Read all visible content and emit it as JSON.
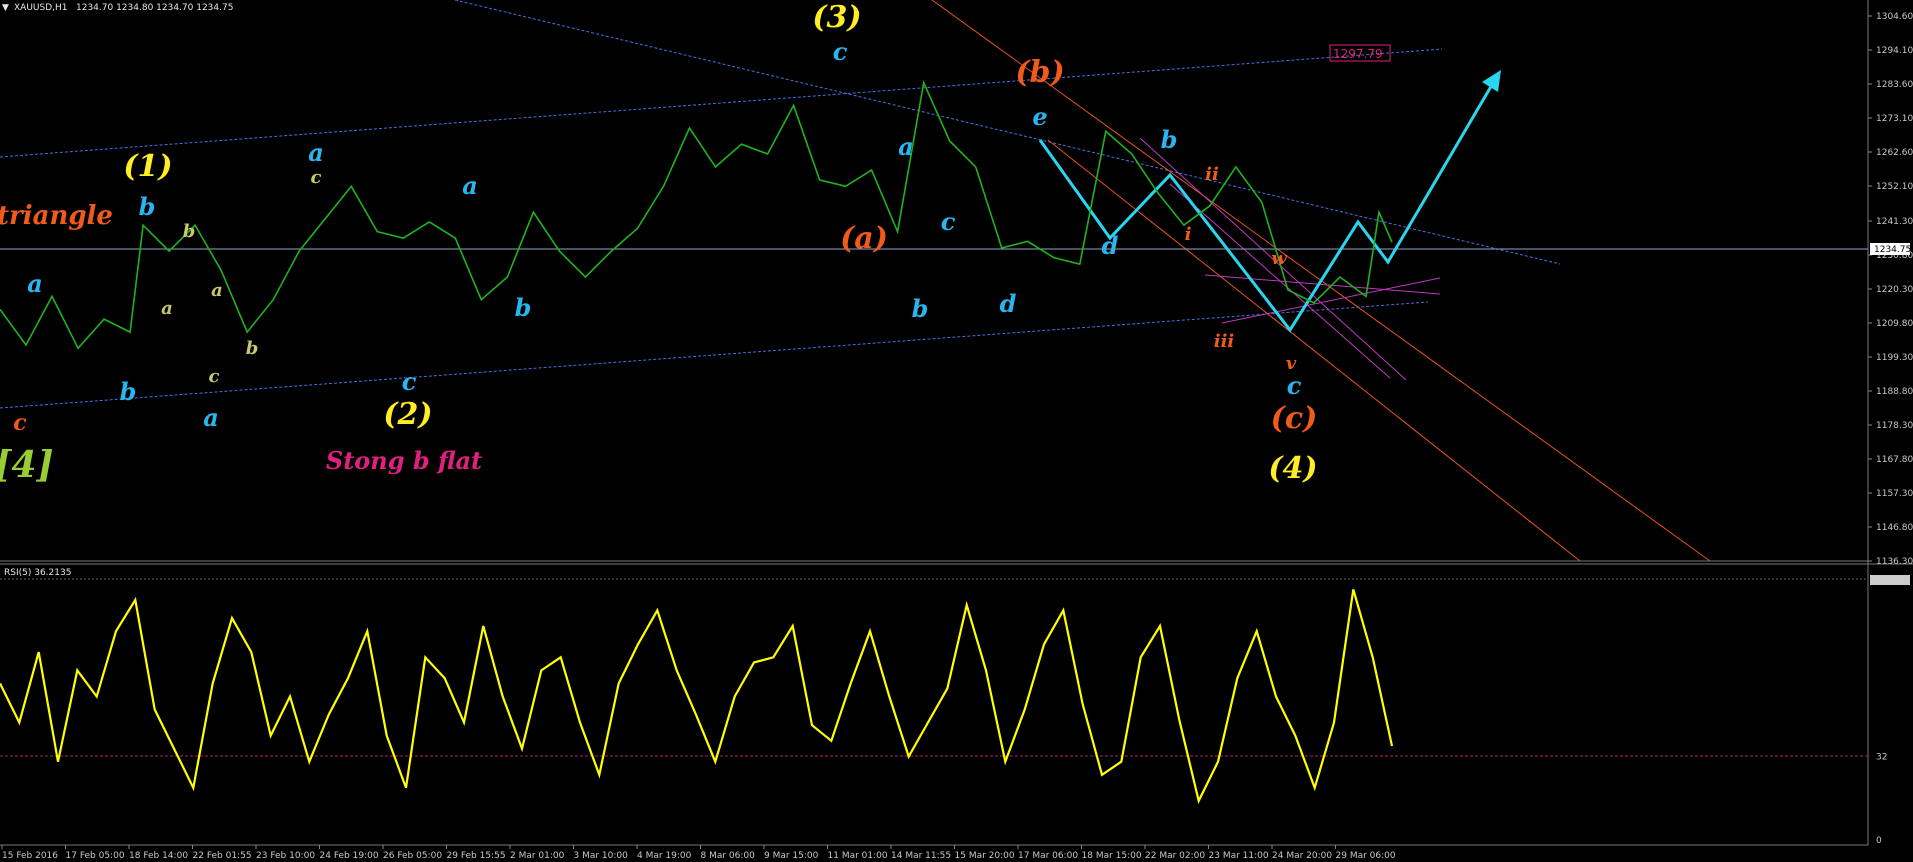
{
  "header": {
    "symbol": "XAUUSD,H1",
    "ohlc": "1234.70 1234.80 1234.70 1234.75",
    "indicator": "RSI(5) 36.2135"
  },
  "chart_data": [
    {
      "type": "line",
      "instrument": "XAUUSD",
      "timeframe": "H1",
      "ylim": [
        1136.3,
        1304.6
      ],
      "y_ticks": [
        "1304.60",
        "1294.10",
        "1283.60",
        "1273.10",
        "1262.60",
        "1252.10",
        "1241.30",
        "1230.80",
        "1220.30",
        "1209.80",
        "1199.30",
        "1188.80",
        "1178.30",
        "1167.80",
        "1157.30",
        "1146.80",
        "1136.30"
      ],
      "x_ticks": [
        "15 Feb 2016",
        "17 Feb 05:00",
        "18 Feb 14:00",
        "22 Feb 01:55",
        "23 Feb 10:00",
        "24 Feb 19:00",
        "26 Feb 05:00",
        "29 Feb 15:55",
        "2 Mar 01:00",
        "3 Mar 10:00",
        "4 Mar 19:00",
        "8 Mar 06:00",
        "9 Mar 15:00",
        "11 Mar 01:00",
        "14 Mar 11:55",
        "15 Mar 20:00",
        "17 Mar 06:00",
        "18 Mar 15:00",
        "22 Mar 02:00",
        "23 Mar 11:00",
        "24 Mar 20:00",
        "29 Mar 06:00"
      ],
      "current_price": "1234.75",
      "price_label": "1297.79",
      "series": [
        {
          "color": "#1fb31f",
          "x_index": [
            0,
            0.4,
            0.8,
            1.2,
            1.6,
            2.0,
            2.2,
            2.6,
            3.0,
            3.4,
            3.8,
            4.2,
            4.6,
            5.0,
            5.4,
            5.8,
            6.2,
            6.6,
            7.0,
            7.4,
            7.8,
            8.2,
            8.6,
            9.0,
            9.4,
            9.8,
            10.2,
            10.6,
            11.0,
            11.4,
            11.8,
            12.2,
            12.6,
            13.0,
            13.4,
            13.8,
            14.2,
            14.6,
            15.0,
            15.4,
            15.8,
            16.2,
            16.6,
            17.0,
            17.4,
            17.8,
            18.2,
            18.6,
            19.0,
            19.4,
            19.8,
            20.2,
            20.6,
            21.0,
            21.2,
            21.4
          ],
          "values": [
            1214,
            1203,
            1218,
            1202,
            1211,
            1207,
            1240,
            1232,
            1240,
            1226,
            1207,
            1217,
            1232,
            1242,
            1252,
            1238,
            1236,
            1241,
            1236,
            1217,
            1224,
            1244,
            1232,
            1224,
            1232,
            1239,
            1252,
            1270,
            1258,
            1265,
            1262,
            1277,
            1254,
            1252,
            1257,
            1238,
            1284,
            1266,
            1258,
            1233,
            1235,
            1230,
            1228,
            1269,
            1262,
            1250,
            1240,
            1246,
            1258,
            1247,
            1220,
            1216,
            1224,
            1218,
            1244,
            1234.75
          ]
        }
      ],
      "elliott_labels": {
        "yellow": [
          "(3)",
          "(1)",
          "(2)",
          "(4)",
          "[4]"
        ],
        "orange": [
          "(b)",
          "(a)",
          "(c)",
          "triangle",
          "c",
          "ii",
          "i",
          "w",
          "iii",
          "v"
        ],
        "blue": [
          "c",
          "a",
          "b",
          "a",
          "a",
          "b",
          "c",
          "a",
          "b",
          "a",
          "c",
          "b",
          "d",
          "e",
          "d",
          "b",
          "c"
        ],
        "small": [
          "c",
          "b",
          "a",
          "a",
          "b",
          "c"
        ],
        "magenta": [
          "Stong b flat"
        ]
      }
    },
    {
      "type": "line",
      "indicator": "RSI(5)",
      "ylim": [
        0,
        100
      ],
      "y_ticks": [
        "100",
        "32",
        "0"
      ],
      "last_value": "36.2135",
      "level": 32,
      "series": [
        {
          "color": "#ffff00",
          "values": [
            60,
            45,
            72,
            30,
            65,
            55,
            80,
            92,
            50,
            35,
            20,
            60,
            85,
            72,
            40,
            55,
            30,
            48,
            62,
            80,
            40,
            20,
            70,
            62,
            45,
            82,
            55,
            35,
            65,
            70,
            45,
            25,
            60,
            75,
            88,
            65,
            48,
            30,
            55,
            68,
            70,
            82,
            44,
            38,
            60,
            80,
            55,
            32,
            45,
            58,
            90,
            65,
            30,
            50,
            75,
            88,
            52,
            25,
            30,
            70,
            82,
            46,
            15,
            30,
            62,
            80,
            55,
            40,
            20,
            45,
            96,
            70,
            36
          ]
        }
      ]
    }
  ]
}
